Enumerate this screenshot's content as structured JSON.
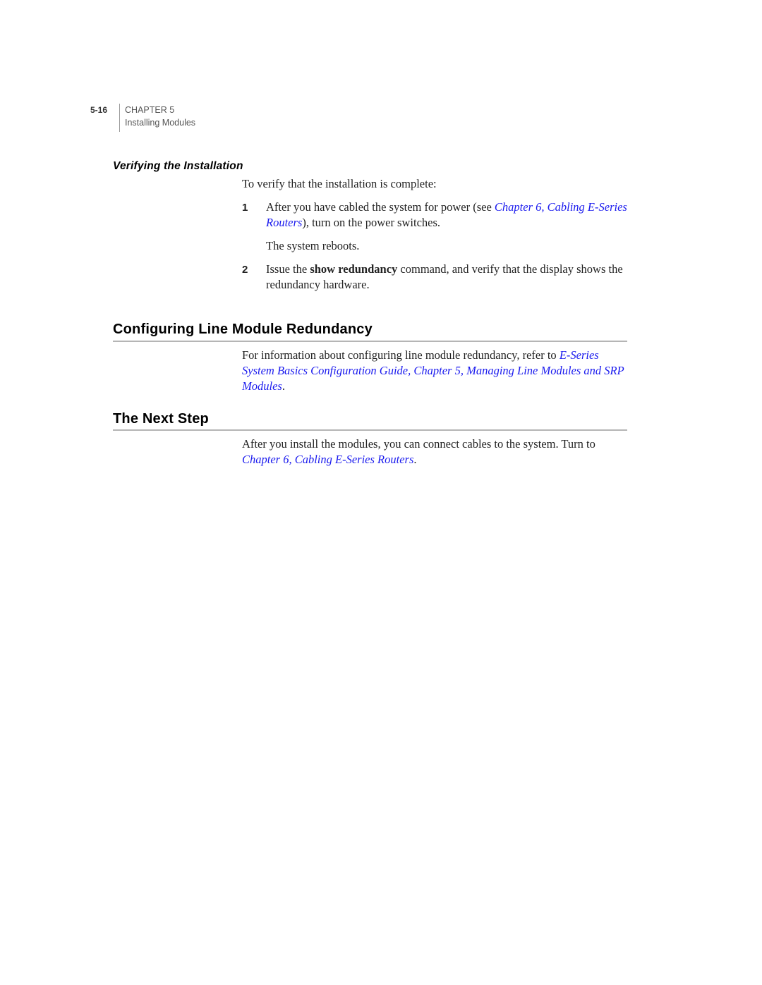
{
  "running_head": {
    "page_number": "5-16",
    "chapter": "CHAPTER 5",
    "chapter_title": "Installing Modules"
  },
  "verifying": {
    "heading": "Verifying the Installation",
    "intro": "To verify that the installation is complete:",
    "steps": [
      {
        "number": "1",
        "text_before": "After you have cabled the system for power (see ",
        "link": "Chapter 6, Cabling E-Series Routers",
        "text_after": "), turn on the power switches.",
        "result": "The system reboots."
      },
      {
        "number": "2",
        "text_before": "Issue the ",
        "command": "show redundancy",
        "text_after": " command, and verify that the display shows the redundancy hardware."
      }
    ]
  },
  "configuring": {
    "heading": "Configuring Line Module Redundancy",
    "text_before": "For information about configuring line module redundancy, refer to ",
    "link": "E-Series System Basics Configuration Guide, Chapter 5, Managing Line Modules and SRP Modules",
    "text_after": "."
  },
  "next_step": {
    "heading": "The Next Step",
    "text_before": "After you install the modules, you can connect cables to the system. Turn to ",
    "link": "Chapter 6, Cabling E-Series Routers",
    "text_after": "."
  },
  "colors": {
    "link": "#1a1aee",
    "rule": "#b5b5b5"
  }
}
